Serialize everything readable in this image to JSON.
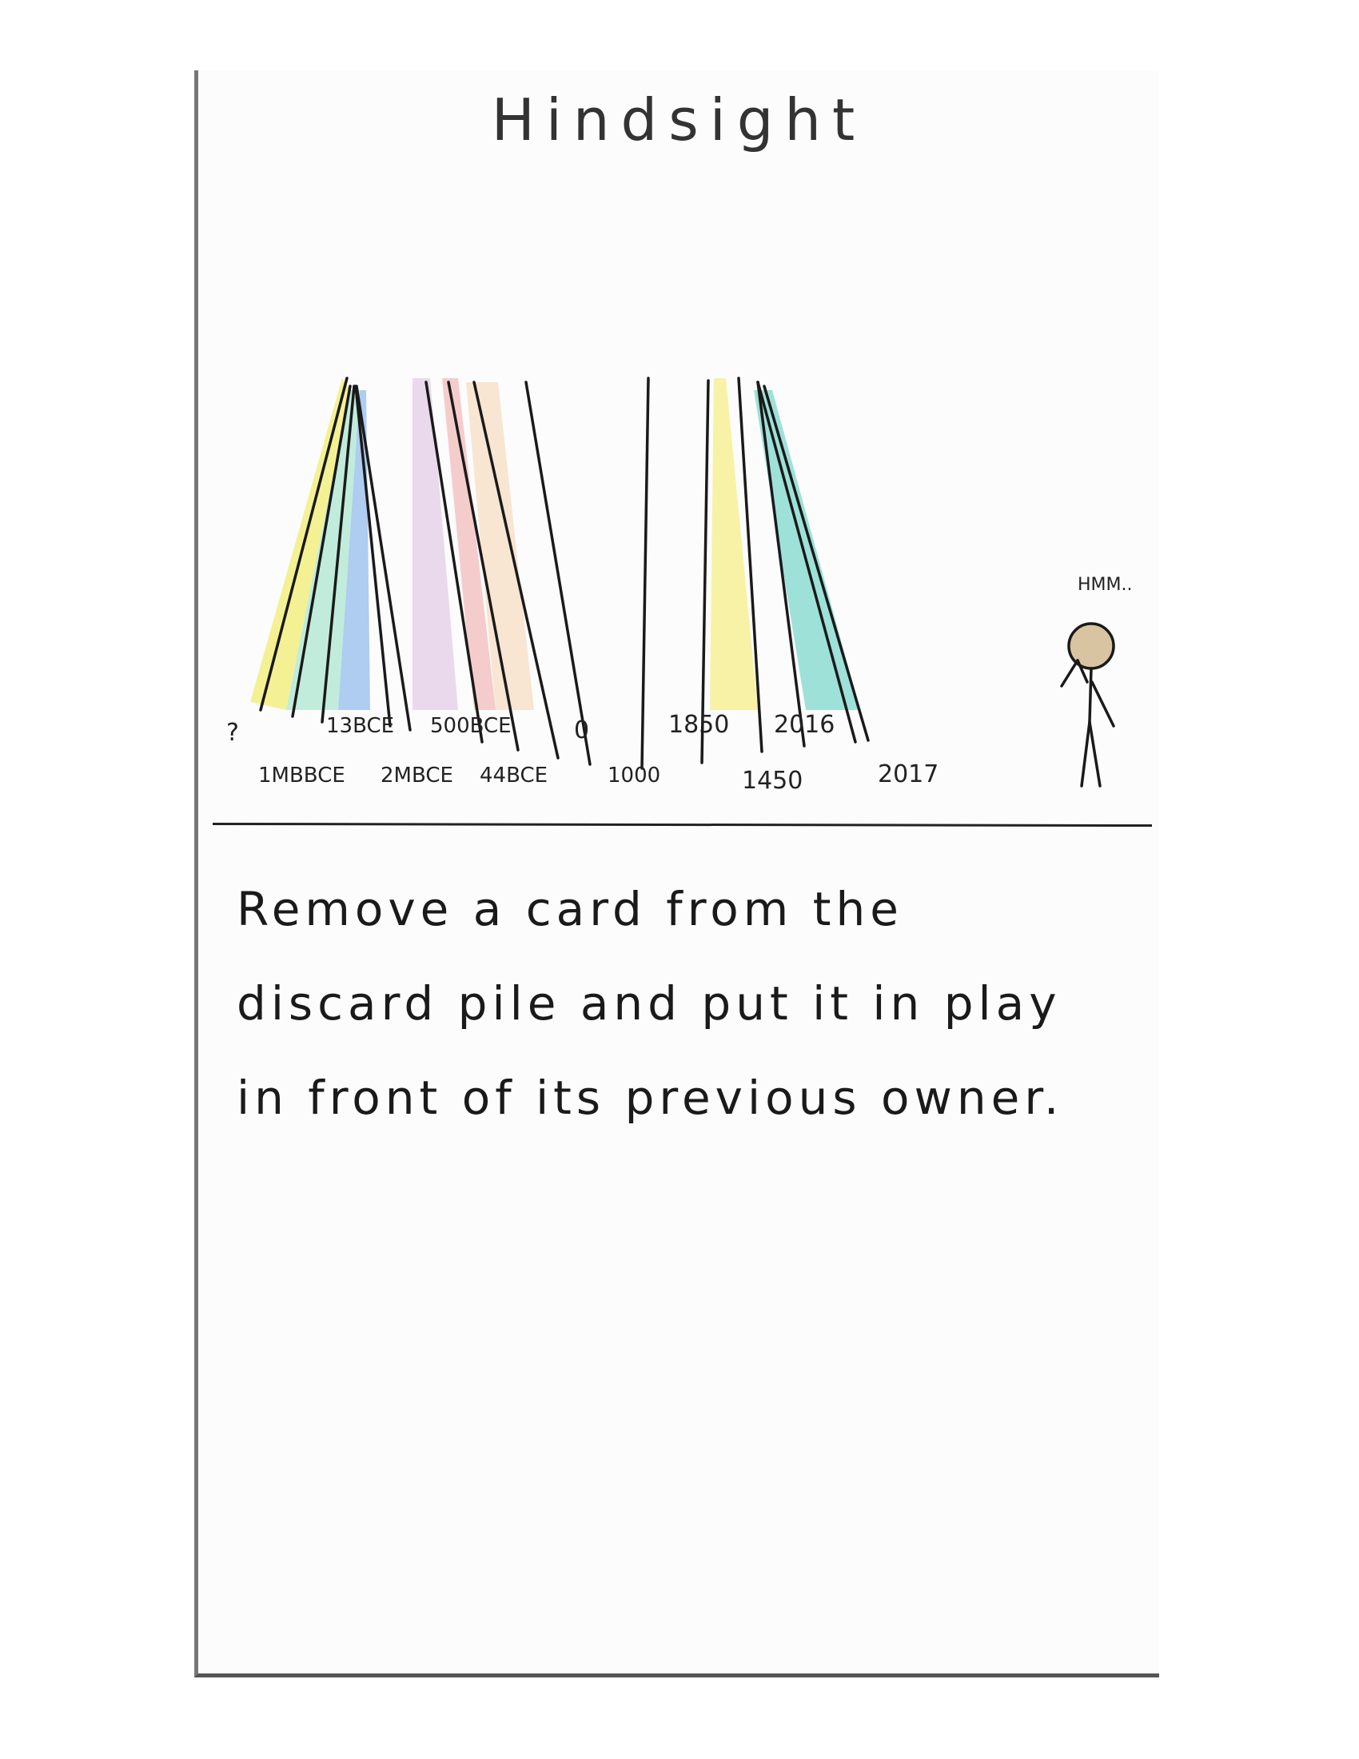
{
  "card": {
    "title": "Hindsight",
    "description": "Remove a card from the discard pile and put it in play in front of its previous owner.",
    "speech": "HMM.."
  },
  "timeline": {
    "top_row": [
      "?",
      "13BCE",
      "500BCE",
      "0",
      "1850",
      "2016"
    ],
    "bottom_row": [
      "1MBBCE",
      "2MBCE",
      "44BCE",
      "1000",
      "1450",
      "2017"
    ],
    "stripe_colors": [
      "#f0ee70",
      "#a8e6cf",
      "#8fb8ec",
      "#e3cbe6",
      "#f2b8b8",
      "#f7dcc0",
      "#f5ee80",
      "#7fd8cc"
    ]
  }
}
